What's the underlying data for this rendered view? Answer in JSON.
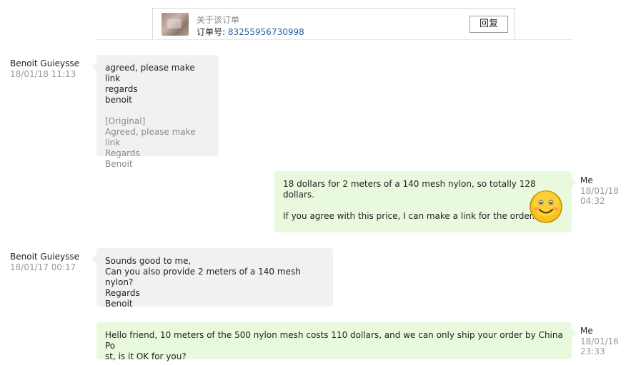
{
  "order": {
    "about_label": "关于该订单",
    "number_label": "订单号: ",
    "number": "83255956730998",
    "reply_label": "回复"
  },
  "messages": [
    {
      "sender": "Benoit Guieysse",
      "time": "18/01/18 11:13",
      "lines": [
        "agreed, please make link",
        "regards",
        "benoit"
      ],
      "original": [
        "[Original]",
        "Agreed, please make link",
        "Regards",
        "Benoit"
      ]
    },
    {
      "sender": "Me",
      "time": "18/01/18 04:32",
      "lines": [
        "18 dollars for 2 meters of a 140 mesh nylon, so totally 128 dollars.",
        "",
        "If you agree with this price, I can make a link for the order."
      ],
      "emoji": "smiley-face-icon"
    },
    {
      "sender": "Benoit Guieysse",
      "time": "18/01/17 00:17",
      "lines": [
        "Sounds good to me,",
        "Can you also provide 2 meters of a 140 mesh nylon?",
        "Regards",
        "Benoit"
      ]
    },
    {
      "sender": "Me",
      "time": "18/01/16 23:33",
      "lines": [
        "Hello friend, 10 meters of the 500 nylon mesh costs 110 dollars, and we can only ship your order by China Po",
        "st, is it OK for you?"
      ]
    }
  ]
}
